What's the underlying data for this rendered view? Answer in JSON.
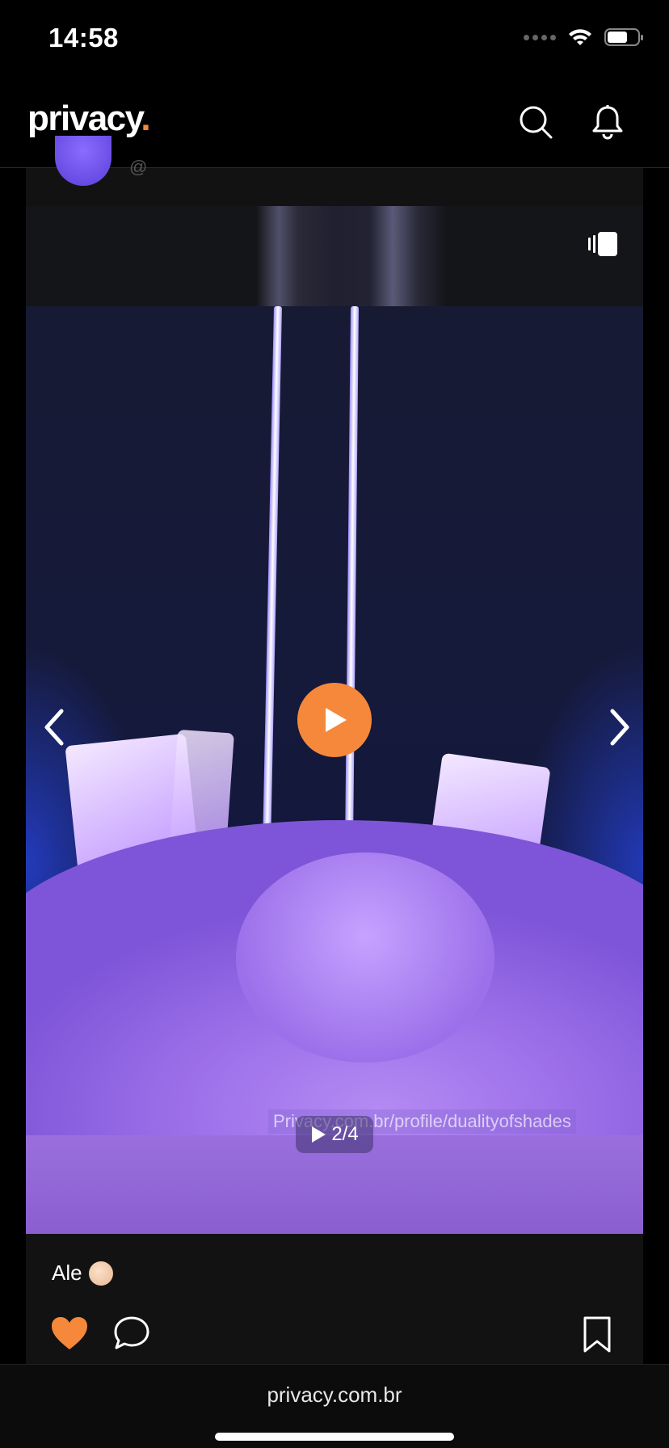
{
  "status_bar": {
    "time": "14:58"
  },
  "header": {
    "logo_text": "privacy",
    "logo_dot": "."
  },
  "post": {
    "handle": "@",
    "caption": "Ale",
    "media": {
      "watermark": "Privacy.com.br/profile/dualityofshades",
      "counter": "2/4",
      "current_index": 2,
      "total": 4
    }
  },
  "browser": {
    "url": "privacy.com.br"
  },
  "colors": {
    "accent": "#f5883a",
    "background": "#000000",
    "card": "#121212"
  },
  "icons": [
    "search-icon",
    "bell-icon",
    "multi-media-icon",
    "chevron-left-icon",
    "chevron-right-icon",
    "play-icon",
    "heart-icon",
    "comment-icon",
    "bookmark-icon"
  ]
}
